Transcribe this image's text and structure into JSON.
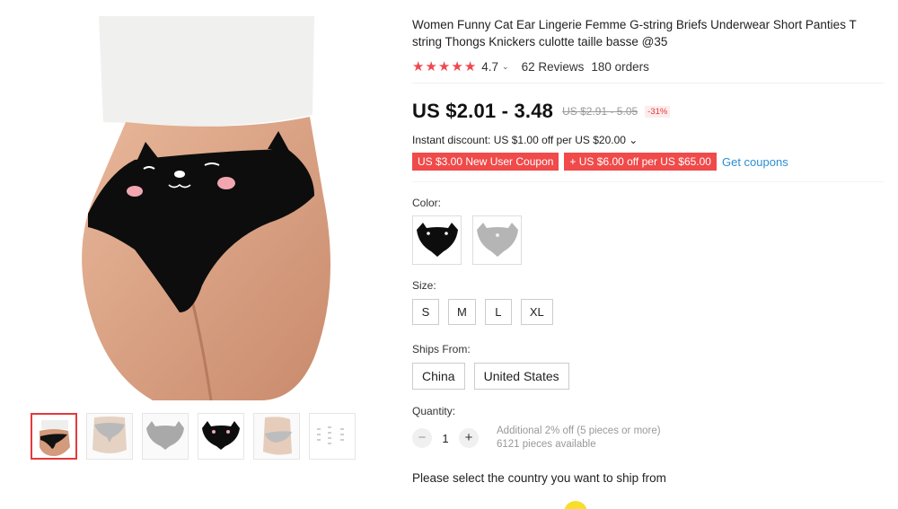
{
  "product": {
    "title": "Women Funny Cat Ear Lingerie Femme G-string Briefs Underwear Short Panties T string Thongs Knickers culotte taille basse @35",
    "rating": "4.7",
    "rating_chevron": "⌄",
    "reviews": "62 Reviews",
    "orders": "180 orders",
    "price": "US $2.01 - 3.48",
    "original_price": "US $2.91 - 5.05",
    "discount": "-31%",
    "instant_discount": "Instant discount: US $1.00 off per US $20.00 ⌄",
    "coupons": [
      "US $3.00 New User Coupon",
      "+ US $6.00 off per US $65.00"
    ],
    "get_coupons": "Get coupons",
    "colors": {
      "label": "Color:",
      "options": [
        {
          "icon": "black-cat-panty-swatch"
        },
        {
          "icon": "gray-cat-panty-swatch"
        }
      ]
    },
    "sizes": {
      "label": "Size:",
      "options": [
        "S",
        "M",
        "L",
        "XL"
      ]
    },
    "ships_from": {
      "label": "Ships From:",
      "options": [
        "China",
        "United States"
      ]
    },
    "quantity": {
      "label": "Quantity:",
      "minus": "−",
      "value": "1",
      "plus": "+",
      "note_line1": "Additional 2% off (5 pieces or more)",
      "note_line2": "6121 pieces available"
    },
    "ship_notice": "Please select the country you want to ship from"
  },
  "accent_colors": {
    "star": "#f0484f",
    "coupon": "#f04a4a",
    "link": "#2a8fd4"
  }
}
